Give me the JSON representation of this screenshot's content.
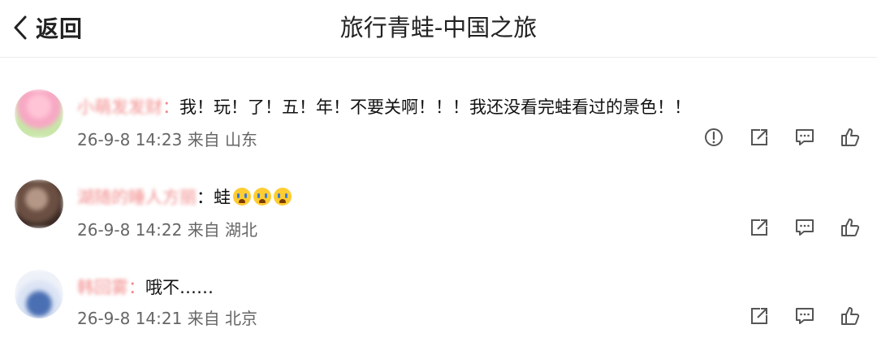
{
  "header": {
    "back_label": "返回",
    "title": "旅行青蛙-中国之旅"
  },
  "comments": [
    {
      "username": "小萌发发财",
      "text": "我！玩！了！五！年！不要关啊！！！我还没看完蛙看过的景色！！",
      "emojis": [],
      "time": "26-9-8 14:23",
      "location": "来自 山东",
      "has_report": true
    },
    {
      "username": "湖随的睡人方丽",
      "text": "蛙",
      "emojis": [
        "crying-face",
        "crying-face",
        "crying-face"
      ],
      "time": "26-9-8 14:22",
      "location": "来自 湖北",
      "has_report": false
    },
    {
      "username": "韩回雾",
      "text": "哦不……",
      "emojis": [],
      "time": "26-9-8 14:21",
      "location": "来自 北京",
      "has_report": false
    }
  ],
  "icons": {
    "back": "chevron-left-icon",
    "report": "exclamation-circle-icon",
    "share": "share-icon",
    "reply": "comment-icon",
    "like": "thumbs-up-icon"
  },
  "colors": {
    "username": "#f28b8b",
    "meta": "#666666",
    "icon": "#555555"
  }
}
